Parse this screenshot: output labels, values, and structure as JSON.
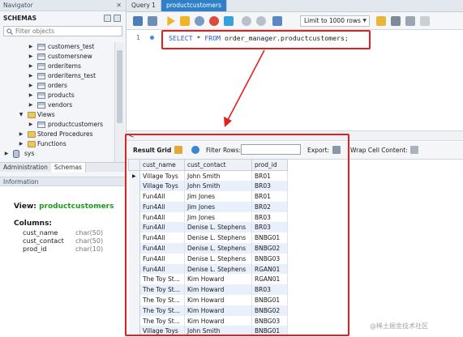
{
  "navigator": {
    "title": "Navigator",
    "schemas_label": "SCHEMAS",
    "filter_placeholder": "Filter objects",
    "tree": [
      {
        "label": "customers_test",
        "kind": "table"
      },
      {
        "label": "customersnew",
        "kind": "table"
      },
      {
        "label": "orderitems",
        "kind": "table"
      },
      {
        "label": "orderitems_test",
        "kind": "table"
      },
      {
        "label": "orders",
        "kind": "table"
      },
      {
        "label": "products",
        "kind": "table"
      },
      {
        "label": "vendors",
        "kind": "table"
      },
      {
        "label": "Views",
        "kind": "folder"
      },
      {
        "label": "productcustomers",
        "kind": "view"
      },
      {
        "label": "Stored Procedures",
        "kind": "folder"
      },
      {
        "label": "Functions",
        "kind": "folder"
      },
      {
        "label": "sys",
        "kind": "schema"
      }
    ],
    "bottom_tabs": [
      "Administration",
      "Schemas"
    ]
  },
  "information": {
    "title": "Information",
    "view_prefix": "View:",
    "view_name": "productcustomers",
    "columns_label": "Columns:",
    "columns": [
      {
        "name": "cust_name",
        "type": "char(50)"
      },
      {
        "name": "cust_contact",
        "type": "char(50)"
      },
      {
        "name": "prod_id",
        "type": "char(10)"
      }
    ]
  },
  "editor": {
    "tabs": [
      "Query 1",
      "productcustomers"
    ],
    "limit_label": "Limit to 1000 rows",
    "line_number": "1",
    "sql": {
      "kw1": "SELECT",
      "star": " * ",
      "kw2": "FROM",
      "rest": " order_manager.productcustomers;"
    }
  },
  "results": {
    "result_grid_label": "Result Grid",
    "filter_rows_label": "Filter Rows:",
    "export_label": "Export:",
    "wrap_label": "Wrap Cell Content:",
    "headers": [
      "cust_name",
      "cust_contact",
      "prod_id"
    ],
    "rows": [
      [
        "Village Toys",
        "John Smith",
        "BR01"
      ],
      [
        "Village Toys",
        "John Smith",
        "BR03"
      ],
      [
        "Fun4All",
        "Jim Jones",
        "BR01"
      ],
      [
        "Fun4All",
        "Jim Jones",
        "BR02"
      ],
      [
        "Fun4All",
        "Jim Jones",
        "BR03"
      ],
      [
        "Fun4All",
        "Denise L. Stephens",
        "BR03"
      ],
      [
        "Fun4All",
        "Denise L. Stephens",
        "BNBG01"
      ],
      [
        "Fun4All",
        "Denise L. Stephens",
        "BNBG02"
      ],
      [
        "Fun4All",
        "Denise L. Stephens",
        "BNBG03"
      ],
      [
        "Fun4All",
        "Denise L. Stephens",
        "RGAN01"
      ],
      [
        "The Toy St...",
        "Kim Howard",
        "RGAN01"
      ],
      [
        "The Toy St...",
        "Kim Howard",
        "BR03"
      ],
      [
        "The Toy St...",
        "Kim Howard",
        "BNBG01"
      ],
      [
        "The Toy St...",
        "Kim Howard",
        "BNBG02"
      ],
      [
        "The Toy St...",
        "Kim Howard",
        "BNBG03"
      ],
      [
        "Village Toys",
        "John Smith",
        "BNBG01"
      ]
    ]
  },
  "watermark": "@稀土掘金技术社区",
  "colors": {
    "accent": "#2f80c8",
    "highlight": "#e32020",
    "view_name": "#1f9a1f",
    "sql_keyword": "#2a59c7"
  }
}
